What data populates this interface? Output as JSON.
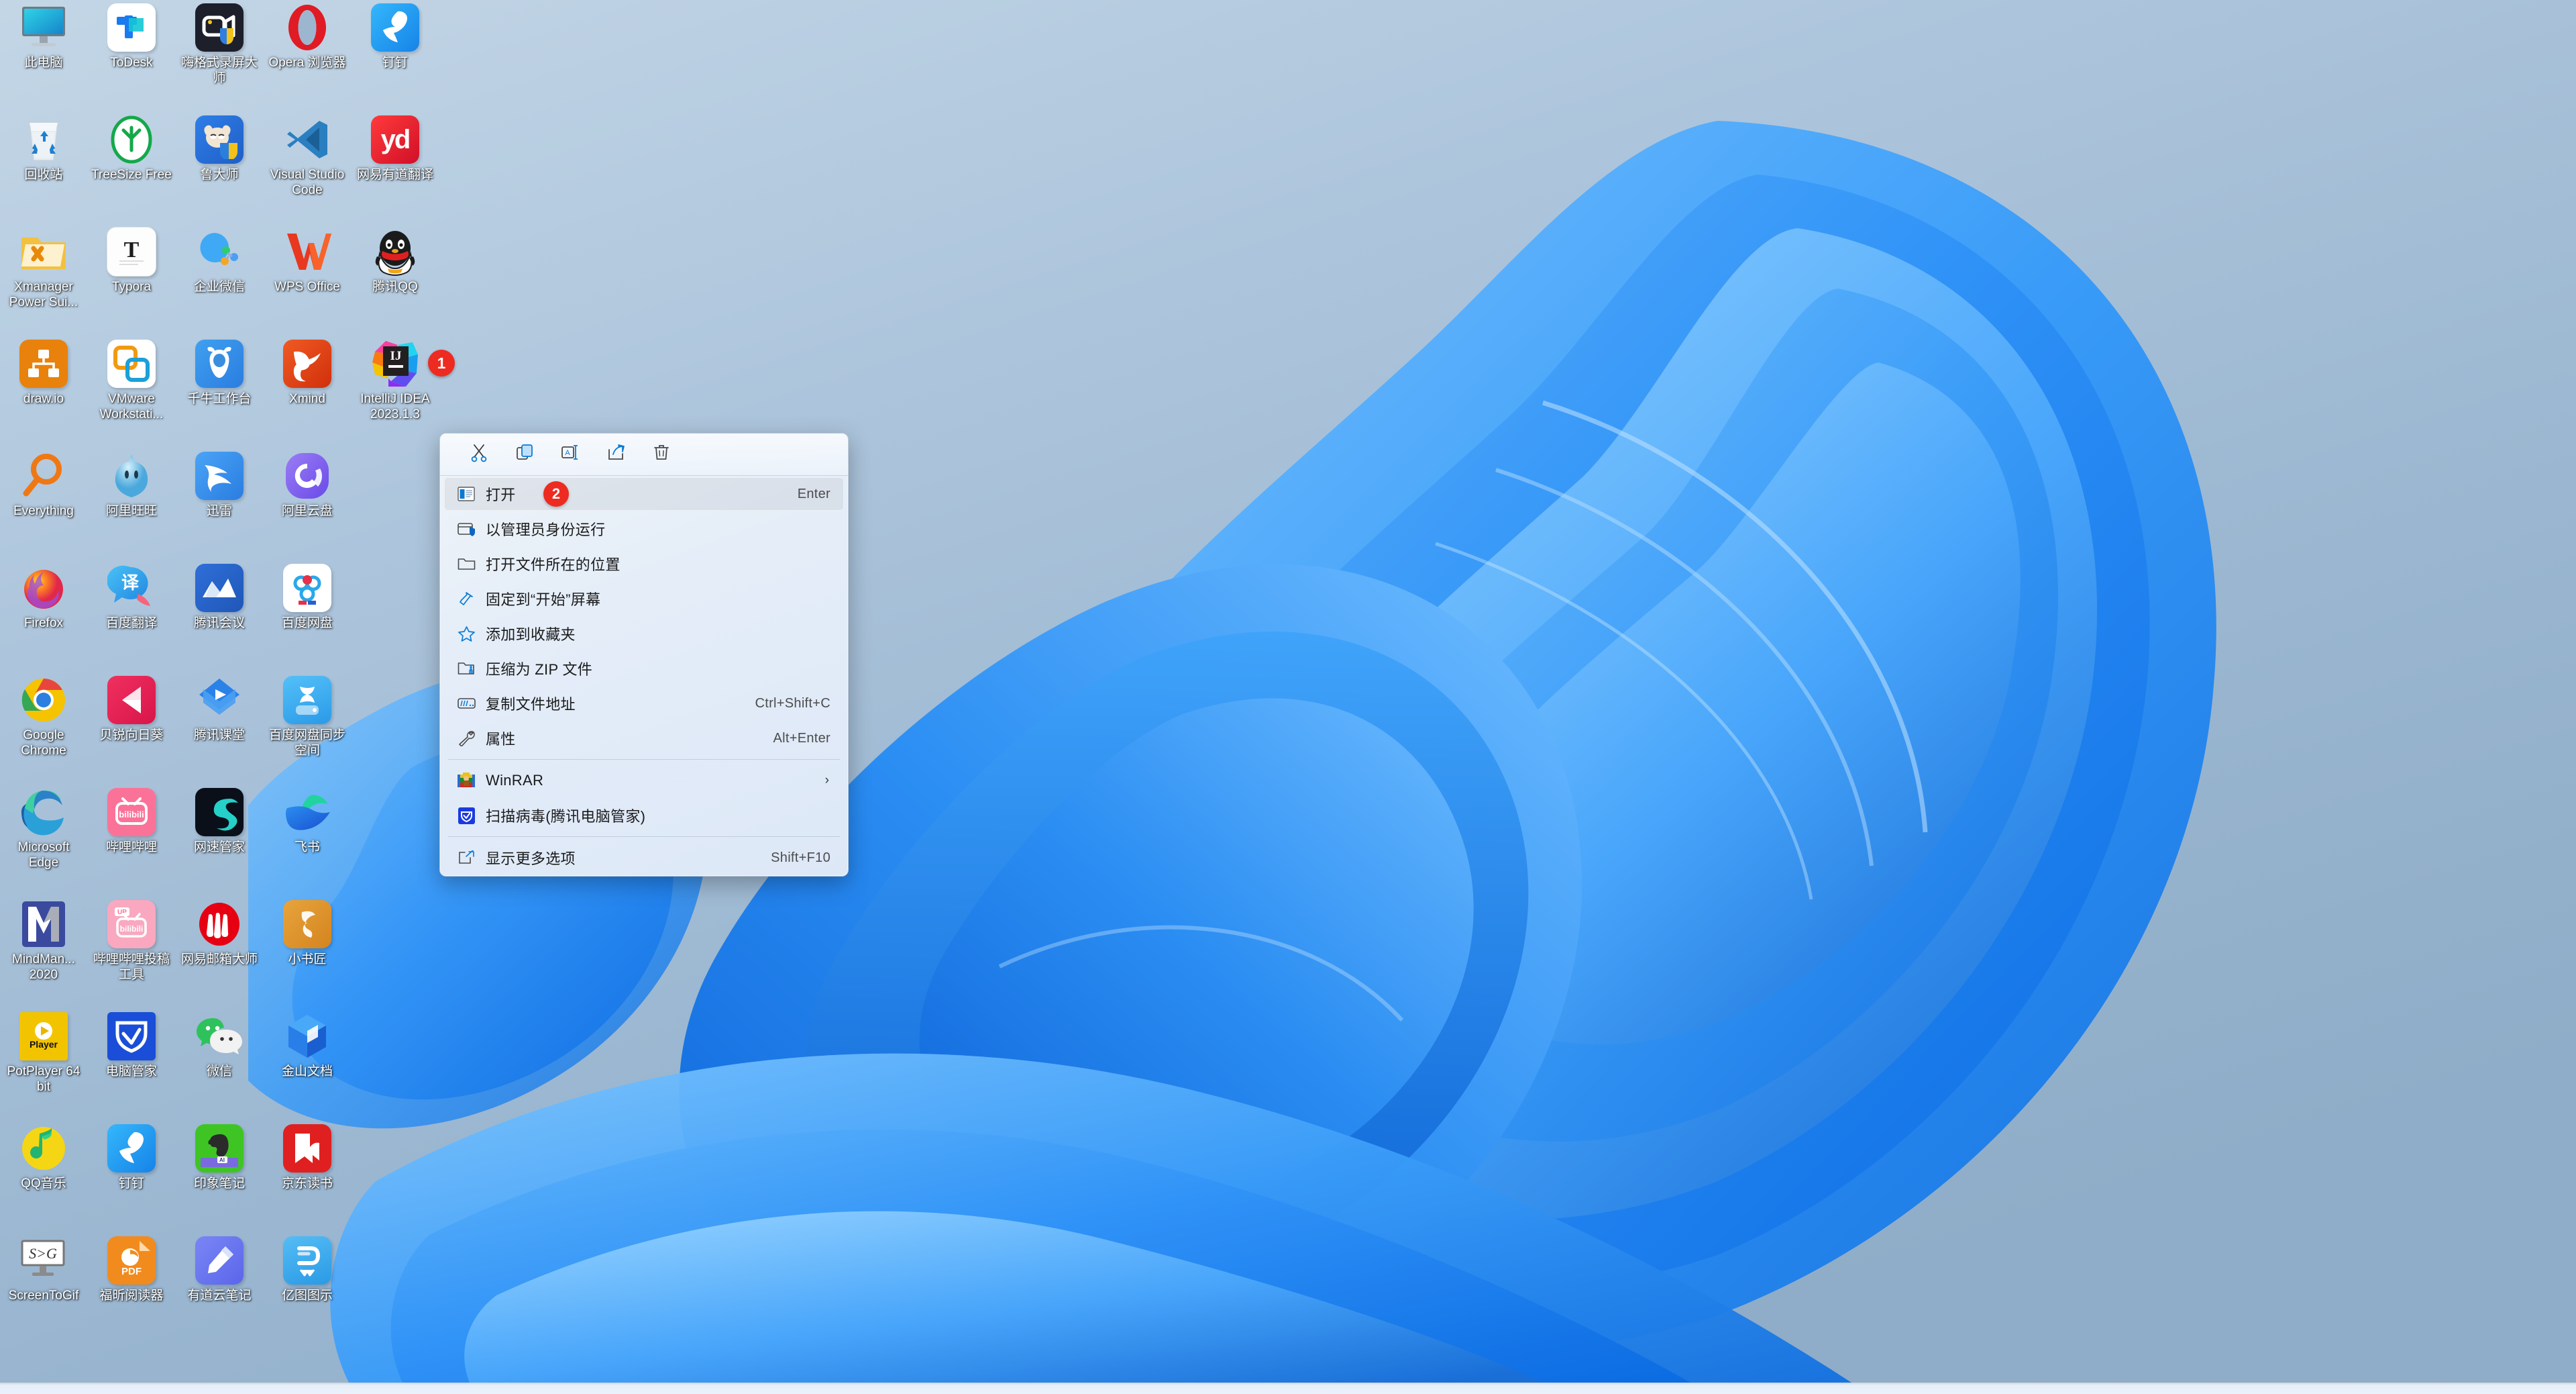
{
  "desktop": {
    "wallpaper_name": "windows-11-bloom-wallpaper",
    "background_color": "#9cb6d0",
    "icons": [
      {
        "label": "此电脑",
        "icon": "this-pc-icon",
        "col": 0,
        "row": 0,
        "type": "monitor"
      },
      {
        "label": "ToDesk",
        "icon": "todesk-icon",
        "col": 1,
        "row": 0,
        "type": "todesk"
      },
      {
        "label": "嗨格式录屏大师",
        "icon": "higeshi-recorder-icon",
        "col": 2,
        "row": 0,
        "type": "recorder"
      },
      {
        "label": "Opera 浏览器",
        "icon": "opera-browser-icon",
        "col": 3,
        "row": 0,
        "type": "opera"
      },
      {
        "label": "钉钉",
        "icon": "dingtalk-icon",
        "col": 4,
        "row": 0,
        "type": "dingtalk"
      },
      {
        "label": "回收站",
        "icon": "recycle-bin-icon",
        "col": 0,
        "row": 1,
        "type": "recyclebin"
      },
      {
        "label": "TreeSize Free",
        "icon": "treesize-free-icon",
        "col": 1,
        "row": 1,
        "type": "treesize"
      },
      {
        "label": "鲁大师",
        "icon": "ludashi-icon",
        "col": 2,
        "row": 1,
        "type": "ludashi"
      },
      {
        "label": "Visual Studio Code",
        "icon": "vscode-icon",
        "col": 3,
        "row": 1,
        "type": "vscode"
      },
      {
        "label": "网易有道翻译",
        "icon": "youdao-translate-icon",
        "col": 4,
        "row": 1,
        "type": "youdao"
      },
      {
        "label": "Xmanager Power Sui...",
        "icon": "xmanager-folder-icon",
        "col": 0,
        "row": 2,
        "type": "xmanager"
      },
      {
        "label": "Typora",
        "icon": "typora-icon",
        "col": 1,
        "row": 2,
        "type": "typora"
      },
      {
        "label": "企业微信",
        "icon": "wecom-icon",
        "col": 2,
        "row": 2,
        "type": "wecom"
      },
      {
        "label": "WPS Office",
        "icon": "wps-office-icon",
        "col": 3,
        "row": 2,
        "type": "wps"
      },
      {
        "label": "腾讯QQ",
        "icon": "tencent-qq-icon",
        "col": 4,
        "row": 2,
        "type": "qq"
      },
      {
        "label": "draw.io",
        "icon": "drawio-icon",
        "col": 0,
        "row": 3,
        "type": "drawio"
      },
      {
        "label": "VMware Workstati...",
        "icon": "vmware-workstation-icon",
        "col": 1,
        "row": 3,
        "type": "vmware"
      },
      {
        "label": "千牛工作台",
        "icon": "qianniu-icon",
        "col": 2,
        "row": 3,
        "type": "qianniu"
      },
      {
        "label": "Xmind",
        "icon": "xmind-icon",
        "col": 3,
        "row": 3,
        "type": "xmind"
      },
      {
        "label": "IntelliJ IDEA 2023.1.3",
        "icon": "intellij-idea-icon",
        "col": 4,
        "row": 3,
        "type": "intellij",
        "badge": "1"
      },
      {
        "label": "Everything",
        "icon": "everything-icon",
        "col": 0,
        "row": 4,
        "type": "everything"
      },
      {
        "label": "阿里旺旺",
        "icon": "aliwangwang-icon",
        "col": 1,
        "row": 4,
        "type": "aliww"
      },
      {
        "label": "迅雷",
        "icon": "xunlei-icon",
        "col": 2,
        "row": 4,
        "type": "xunlei"
      },
      {
        "label": "阿里云盘",
        "icon": "aliyun-drive-icon",
        "col": 3,
        "row": 4,
        "type": "aliyundrive"
      },
      {
        "label": "Firefox",
        "icon": "firefox-icon",
        "col": 0,
        "row": 5,
        "type": "firefox"
      },
      {
        "label": "百度翻译",
        "icon": "baidu-translate-icon",
        "col": 1,
        "row": 5,
        "type": "baidufanyi"
      },
      {
        "label": "腾讯会议",
        "icon": "tencent-meeting-icon",
        "col": 2,
        "row": 5,
        "type": "voov"
      },
      {
        "label": "百度网盘",
        "icon": "baidu-netdisk-icon",
        "col": 3,
        "row": 5,
        "type": "baidupan"
      },
      {
        "label": "Google Chrome",
        "icon": "google-chrome-icon",
        "col": 0,
        "row": 6,
        "type": "chrome"
      },
      {
        "label": "贝锐向日葵",
        "icon": "sunlogin-icon",
        "col": 1,
        "row": 6,
        "type": "sunlogin"
      },
      {
        "label": "腾讯课堂",
        "icon": "tencent-ke-icon",
        "col": 2,
        "row": 6,
        "type": "tencentke"
      },
      {
        "label": "百度网盘同步空间",
        "icon": "baidu-netdisk-sync-icon",
        "col": 3,
        "row": 6,
        "type": "baidusync"
      },
      {
        "label": "Microsoft Edge",
        "icon": "microsoft-edge-icon",
        "col": 0,
        "row": 7,
        "type": "edge"
      },
      {
        "label": "哔哩哔哩",
        "icon": "bilibili-icon",
        "col": 1,
        "row": 7,
        "type": "bilibili"
      },
      {
        "label": "网速管家",
        "icon": "netspeed-manager-icon",
        "col": 2,
        "row": 7,
        "type": "netspeed"
      },
      {
        "label": "飞书",
        "icon": "feishu-icon",
        "col": 3,
        "row": 7,
        "type": "feishu"
      },
      {
        "label": "MindMan... 2020",
        "icon": "mindmanager-icon",
        "col": 0,
        "row": 8,
        "type": "mindmanager"
      },
      {
        "label": "哔哩哔哩投稿工具",
        "icon": "bilibili-upload-icon",
        "col": 1,
        "row": 8,
        "type": "biliup"
      },
      {
        "label": "网易邮箱大师",
        "icon": "netease-mail-master-icon",
        "col": 2,
        "row": 8,
        "type": "neteasemail"
      },
      {
        "label": "小书匠",
        "icon": "xiaoshujiang-icon",
        "col": 3,
        "row": 8,
        "type": "xiaoshujiang"
      },
      {
        "label": "PotPlayer 64 bit",
        "icon": "potplayer-icon",
        "col": 0,
        "row": 9,
        "type": "potplayer"
      },
      {
        "label": "电脑管家",
        "icon": "tencent-pc-manager-icon",
        "col": 1,
        "row": 9,
        "type": "pcmanager"
      },
      {
        "label": "微信",
        "icon": "wechat-icon",
        "col": 2,
        "row": 9,
        "type": "wechat"
      },
      {
        "label": "金山文档",
        "icon": "kingsoft-docs-icon",
        "col": 3,
        "row": 9,
        "type": "kdocs"
      },
      {
        "label": "QQ音乐",
        "icon": "qq-music-icon",
        "col": 0,
        "row": 10,
        "type": "qqmusic"
      },
      {
        "label": "钉钉",
        "icon": "dingtalk-icon",
        "col": 1,
        "row": 10,
        "type": "dingtalk"
      },
      {
        "label": "印象笔记",
        "icon": "evernote-icon",
        "col": 2,
        "row": 10,
        "type": "evernote"
      },
      {
        "label": "京东读书",
        "icon": "jd-read-icon",
        "col": 3,
        "row": 10,
        "type": "jdread"
      },
      {
        "label": "ScreenToGif",
        "icon": "screentogif-icon",
        "col": 0,
        "row": 11,
        "type": "screentogif"
      },
      {
        "label": "福昕阅读器",
        "icon": "foxit-reader-icon",
        "col": 1,
        "row": 11,
        "type": "foxit"
      },
      {
        "label": "有道云笔记",
        "icon": "youdao-note-icon",
        "col": 2,
        "row": 11,
        "type": "youdaonote"
      },
      {
        "label": "亿图图示",
        "icon": "edraw-max-icon",
        "col": 3,
        "row": 11,
        "type": "edraw"
      }
    ]
  },
  "context_menu": {
    "toolbar": [
      {
        "name": "cut",
        "icon": "scissors-icon"
      },
      {
        "name": "copy",
        "icon": "copy-icon"
      },
      {
        "name": "rename",
        "icon": "rename-icon"
      },
      {
        "name": "share",
        "icon": "share-icon"
      },
      {
        "name": "delete",
        "icon": "trash-icon"
      }
    ],
    "items": [
      {
        "label": "打开",
        "accel": "Enter",
        "icon": "open-window-icon",
        "selected": true,
        "badge": "2"
      },
      {
        "label": "以管理员身份运行",
        "accel": "",
        "icon": "shield-admin-icon"
      },
      {
        "label": "打开文件所在的位置",
        "accel": "",
        "icon": "folder-icon"
      },
      {
        "label": "固定到“开始”屏幕",
        "accel": "",
        "icon": "pin-icon"
      },
      {
        "label": "添加到收藏夹",
        "accel": "",
        "icon": "star-icon"
      },
      {
        "label": "压缩为 ZIP 文件",
        "accel": "",
        "icon": "zip-folder-icon"
      },
      {
        "label": "复制文件地址",
        "accel": "Ctrl+Shift+C",
        "icon": "copy-path-icon"
      },
      {
        "label": "属性",
        "accel": "Alt+Enter",
        "icon": "wrench-icon"
      },
      {
        "separator": true
      },
      {
        "label": "WinRAR",
        "accel": "",
        "icon": "winrar-icon",
        "submenu": true,
        "chevron": "›"
      },
      {
        "label": "扫描病毒(腾讯电脑管家)",
        "accel": "",
        "icon": "tencent-shield-icon"
      },
      {
        "separator": true
      },
      {
        "label": "显示更多选项",
        "accel": "Shift+F10",
        "icon": "more-options-icon"
      }
    ]
  },
  "colors": {
    "accent": "#0078d4",
    "badge_red": "#ee2b20",
    "menu_bg": "#e4edf8",
    "desktop_bg": "#9cb6d0"
  }
}
